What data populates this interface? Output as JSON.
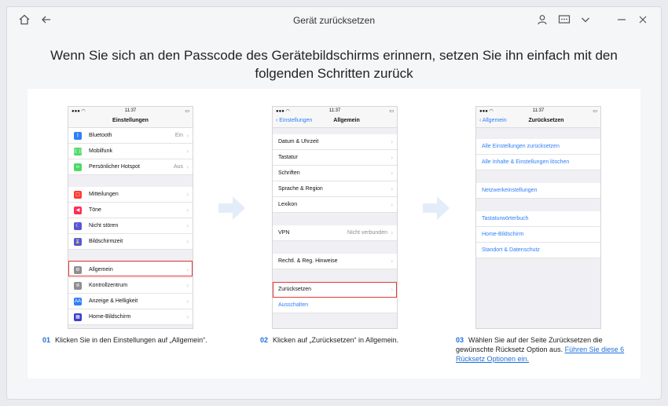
{
  "window": {
    "title": "Gerät zurücksetzen"
  },
  "icons": {
    "home": "home-icon",
    "back": "back-arrow-icon",
    "user": "user-icon",
    "feedback": "feedback-icon",
    "dropdown": "chevron-down-icon",
    "minimize": "minimize-icon",
    "close": "close-icon"
  },
  "headline": "Wenn Sie sich an den Passcode des Gerätebildschirms erinnern, setzen Sie ihn einfach mit den folgenden Schritten zurück",
  "phones": [
    {
      "time": "11:37",
      "nav_title": "Einstellungen",
      "rows": [
        "Bluetooth",
        "Mobilfunk",
        "Persönlicher Hotspot",
        "Mitteilungen",
        "Töne",
        "Nicht stören",
        "Bildschirmzeit",
        "Allgemein",
        "Kontrollzentrum",
        "Anzeige & Helligkeit",
        "Home-Bildschirm"
      ],
      "values": {
        "bluetooth": "Ein",
        "hotspot": "Aus"
      }
    },
    {
      "time": "11:37",
      "back": "Einstellungen",
      "nav_title": "Allgemein",
      "rows": [
        "Datum & Uhrzeit",
        "Tastatur",
        "Schriften",
        "Sprache & Region",
        "Lexikon",
        "VPN",
        "Rechtl. & Reg. Hinweise",
        "Zurücksetzen",
        "Ausschalten"
      ],
      "values": {
        "vpn": "Nicht verbunden"
      }
    },
    {
      "time": "11:37",
      "back": "Allgemein",
      "nav_title": "Zurücksetzen",
      "rows": [
        "Alle Einstellungen zurücksetzen",
        "Alle Inhalte & Einstellungen löschen",
        "Netzwerkeinstellungen",
        "Tastaturwörterbuch",
        "Home-Bildschirm",
        "Standort & Datenschutz"
      ]
    }
  ],
  "steps": [
    {
      "num": "01",
      "text": "Klicken Sie in den Einstellungen auf „Allgemein“."
    },
    {
      "num": "02",
      "text": "Klicken auf „Zurücksetzen“ in Allgemein."
    },
    {
      "num": "03",
      "text": "Wählen Sie auf der Seite Zurücksetzen die gewünschte Rücksetz Option aus.",
      "link": "Führen Sie diese 6 Rücksetz Optionen ein."
    }
  ]
}
